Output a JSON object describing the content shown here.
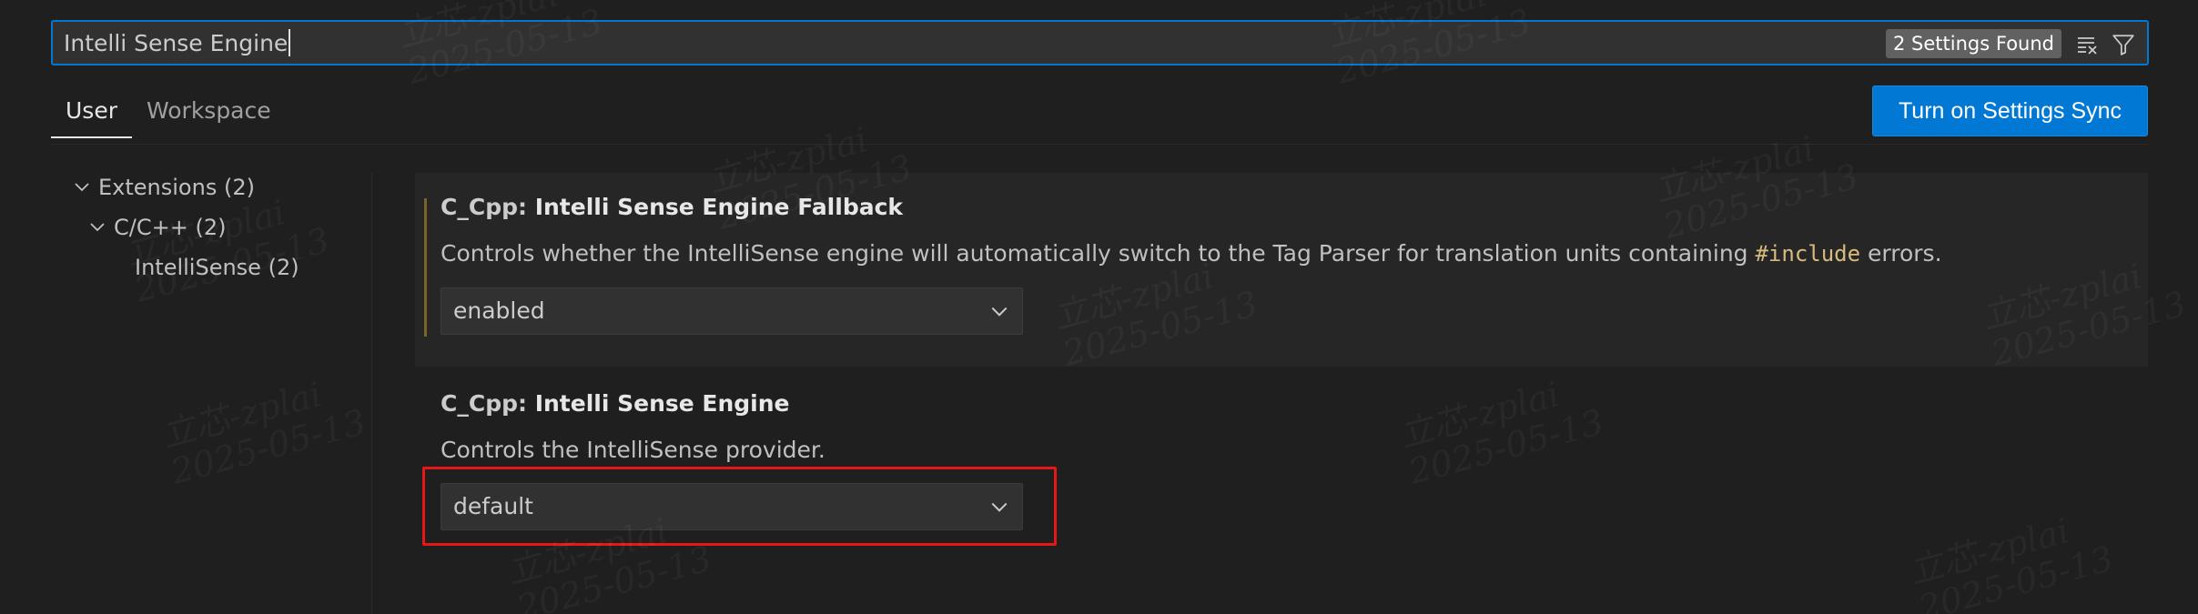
{
  "search": {
    "value": "Intelli Sense Engine",
    "results_badge": "2 Settings Found",
    "clear_icon": "clear-filter-icon",
    "filter_icon": "filter-icon"
  },
  "tabs": [
    {
      "label": "User",
      "active": true
    },
    {
      "label": "Workspace",
      "active": false
    }
  ],
  "sync_button": "Turn on Settings Sync",
  "tree": [
    {
      "label": "Extensions (2)",
      "expanded": true
    },
    {
      "label": "C/C++ (2)",
      "expanded": true
    },
    {
      "label": "IntelliSense (2)"
    }
  ],
  "settings": [
    {
      "category": "C_Cpp: ",
      "name": "Intelli Sense Engine Fallback",
      "description_before": "Controls whether the IntelliSense engine will automatically switch to the Tag Parser for translation units containing ",
      "description_code": "#include",
      "description_after": " errors.",
      "value": "enabled"
    },
    {
      "category": "C_Cpp: ",
      "name": "Intelli Sense Engine",
      "description": "Controls the IntelliSense provider.",
      "value": "default"
    }
  ],
  "watermark": {
    "line1": "立芯-zplai",
    "line2": "2025-05-13"
  },
  "colors": {
    "accent": "#0078d4",
    "highlight": "#e81717",
    "background": "#1f1f1f"
  }
}
